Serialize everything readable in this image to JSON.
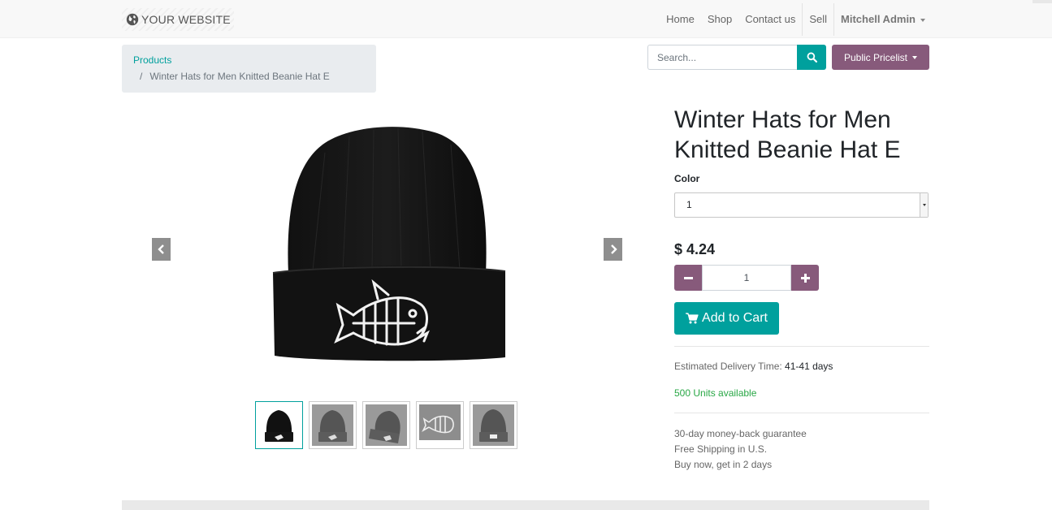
{
  "navbar": {
    "brand": "YOUR WEBSITE",
    "links": [
      "Home",
      "Shop",
      "Contact us",
      "Sell"
    ],
    "user": "Mitchell Admin"
  },
  "breadcrumb": {
    "parent": "Products",
    "separator": "/",
    "current": "Winter Hats for Men Knitted Beanie Hat E"
  },
  "search": {
    "placeholder": "Search..."
  },
  "pricelist": {
    "label": "Public Pricelist"
  },
  "product": {
    "title": "Winter Hats for Men Knitted Beanie Hat E",
    "color_label": "Color",
    "color_value": "1",
    "price": "$ 4.24",
    "quantity": "1",
    "add_to_cart": "Add to Cart",
    "delivery_label": "Estimated Delivery Time:",
    "delivery_value": "41-41 days",
    "stock": "500 Units available",
    "terms": [
      "30-day money-back guarantee",
      "Free Shipping in U.S.",
      "Buy now, get in 2 days"
    ]
  },
  "gallery": {
    "thumbnails": [
      "beanie-black",
      "beanie-gray",
      "beanie-gray-tilted",
      "fish-logo",
      "beanie-back"
    ],
    "active_index": 0
  },
  "colors": {
    "primary": "#00a09d",
    "secondary": "#875a7b",
    "success": "#28a745"
  }
}
